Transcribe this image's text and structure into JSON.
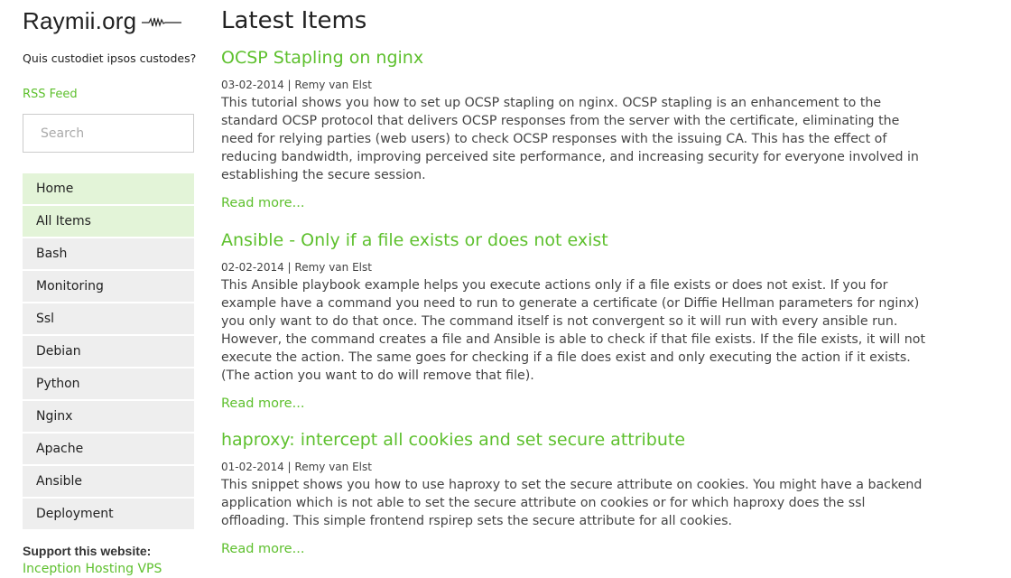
{
  "site": {
    "title": "Raymii.org",
    "tagline": "Quis custodiet ipsos custodes?",
    "rss_label": "RSS Feed",
    "search_placeholder": "Search"
  },
  "nav": {
    "items": [
      {
        "label": "Home",
        "active": true
      },
      {
        "label": "All Items",
        "active": true
      },
      {
        "label": "Bash",
        "active": false
      },
      {
        "label": "Monitoring",
        "active": false
      },
      {
        "label": "Ssl",
        "active": false
      },
      {
        "label": "Debian",
        "active": false
      },
      {
        "label": "Python",
        "active": false
      },
      {
        "label": "Nginx",
        "active": false
      },
      {
        "label": "Apache",
        "active": false
      },
      {
        "label": "Ansible",
        "active": false
      },
      {
        "label": "Deployment",
        "active": false
      }
    ]
  },
  "support": {
    "title": "Support this website:",
    "link_label": "Inception Hosting VPS"
  },
  "main": {
    "page_title": "Latest Items",
    "read_more_label": "Read more...",
    "posts": [
      {
        "title": "OCSP Stapling on nginx",
        "meta": "03-02-2014 | Remy van Elst",
        "excerpt": "This tutorial shows you how to set up OCSP stapling on nginx. OCSP stapling is an enhancement to the standard OCSP protocol that delivers OCSP responses from the server with the certificate, eliminating the need for relying parties (web users) to check OCSP responses with the issuing CA. This has the effect of reducing bandwidth, improving perceived site performance, and increasing security for everyone involved in establishing the secure session."
      },
      {
        "title": "Ansible - Only if a file exists or does not exist",
        "meta": "02-02-2014 | Remy van Elst",
        "excerpt": "This Ansible playbook example helps you execute actions only if a file exists or does not exist. If you for example have a command you need to run to generate a certificate (or Diffie Hellman parameters for nginx) you only want to do that once. The command itself is not convergent so it will run with every ansible run. However, the command creates a file and Ansible is able to check if that file exists. If the file exists, it will not execute the action. The same goes for checking if a file does exist and only executing the action if it exists. (The action you want to do will remove that file)."
      },
      {
        "title": "haproxy: intercept all cookies and set secure attribute",
        "meta": "01-02-2014 | Remy van Elst",
        "excerpt": "This snippet shows you how to use haproxy to set the secure attribute on cookies. You might have a backend application which is not able to set the secure attribute on cookies or for which haproxy does the ssl offloading. This simple frontend rspirep sets the secure attribute for all cookies."
      }
    ]
  },
  "colors": {
    "accent": "#5ec02e",
    "nav_bg": "#eeeeee",
    "nav_active_bg": "#e3f4d8"
  }
}
